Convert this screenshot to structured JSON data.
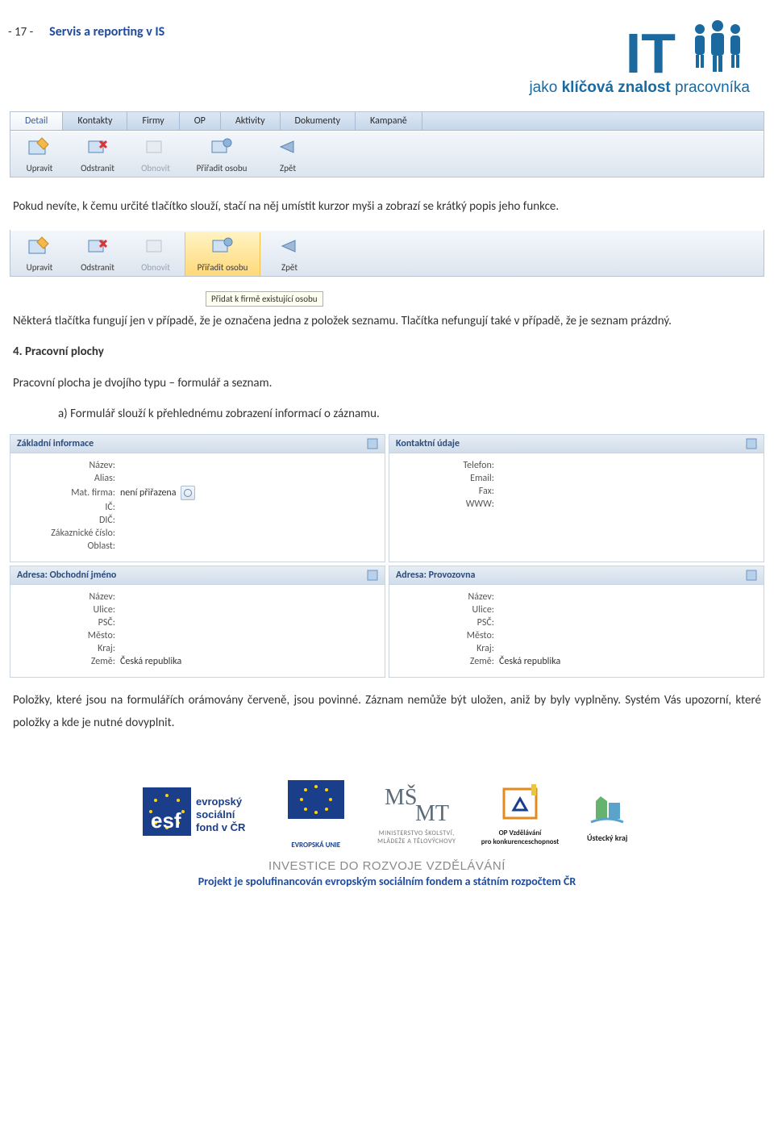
{
  "header": {
    "page_number": "- 17 -",
    "title": "Servis a reporting v IS",
    "logo_tagline_part1": "jako ",
    "logo_tagline_bold": "klíčová znalost",
    "logo_tagline_part2": " pracovníka",
    "logo_main": "IT"
  },
  "toolbar1": {
    "tabs": [
      "Detail",
      "Kontakty",
      "Firmy",
      "OP",
      "Aktivity",
      "Dokumenty",
      "Kampaně"
    ],
    "buttons": {
      "upravit": "Upravit",
      "odstranit": "Odstranit",
      "obnovit": "Obnovit",
      "priradit": "Přiřadit osobu",
      "zpet": "Zpět"
    }
  },
  "paragraph1": "Pokud nevíte, k čemu určité tlačítko slouží, stačí na něj umístit kurzor myši a zobrazí se krátký popis jeho funkce.",
  "toolbar2": {
    "buttons": {
      "upravit": "Upravit",
      "odstranit": "Odstranit",
      "obnovit": "Obnovit",
      "priradit": "Přiřadit osobu",
      "zpet": "Zpět"
    },
    "tooltip": "Přidat k firmě existující osobu"
  },
  "paragraph2": "Některá tlačítka fungují jen v případě, že je označena jedna z položek seznamu. Tlačítka nefungují také v případě, že je seznam prázdný.",
  "section4_title": "4.   Pracovní plochy",
  "section4_p1": "Pracovní plocha je dvojího typu – formulář a seznam.",
  "section4_a": "a)   Formulář slouží k přehlednému zobrazení informací o záznamu.",
  "panels": {
    "p1": {
      "title": "Základní informace",
      "fields": {
        "nazev": "Název:",
        "alias": "Alias:",
        "matfirma_label": "Mat. firma:",
        "matfirma_value": "není přiřazena",
        "ic": "IČ:",
        "dic": "DIČ:",
        "zakcislo": "Zákaznické číslo:",
        "oblast": "Oblast:"
      }
    },
    "p2": {
      "title": "Kontaktní údaje",
      "fields": {
        "telefon": "Telefon:",
        "email": "Email:",
        "fax": "Fax:",
        "www": "WWW:"
      }
    },
    "p3": {
      "title": "Adresa: Obchodní jméno",
      "fields": {
        "nazev": "Název:",
        "ulice": "Ulice:",
        "psc": "PSČ:",
        "mesto": "Město:",
        "kraj": "Kraj:",
        "zeme_label": "Země:",
        "zeme_value": "Česká republika"
      }
    },
    "p4": {
      "title": "Adresa: Provozovna",
      "fields": {
        "nazev": "Název:",
        "ulice": "Ulice:",
        "psc": "PSČ:",
        "mesto": "Město:",
        "kraj": "Kraj:",
        "zeme_label": "Země:",
        "zeme_value": "Česká republika"
      }
    }
  },
  "paragraph3": "Položky, které jsou na formulářích orámovány červeně, jsou povinné. Záznam nemůže být uložen, aniž by byly vyplněny. Systém Vás upozorní, které položky a kde je nutné dovyplnit.",
  "footer": {
    "esf_line1": "evropský",
    "esf_line2": "sociální",
    "esf_line3": "fond v ČR",
    "eu": "EVROPSKÁ UNIE",
    "msmt1": "MINISTERSTVO ŠKOLSTVÍ,",
    "msmt2": "MLÁDEŽE A TĚLOVÝCHOVY",
    "opvk1": "OP Vzdělávání",
    "opvk2": "pro konkurenceschopnost",
    "uk": "Ústecký kraj",
    "caption": "INVESTICE DO ROZVOJE VZDĚLÁVÁNÍ",
    "sub": "Projekt je spolufinancován evropským sociálním fondem a státním rozpočtem ČR"
  }
}
